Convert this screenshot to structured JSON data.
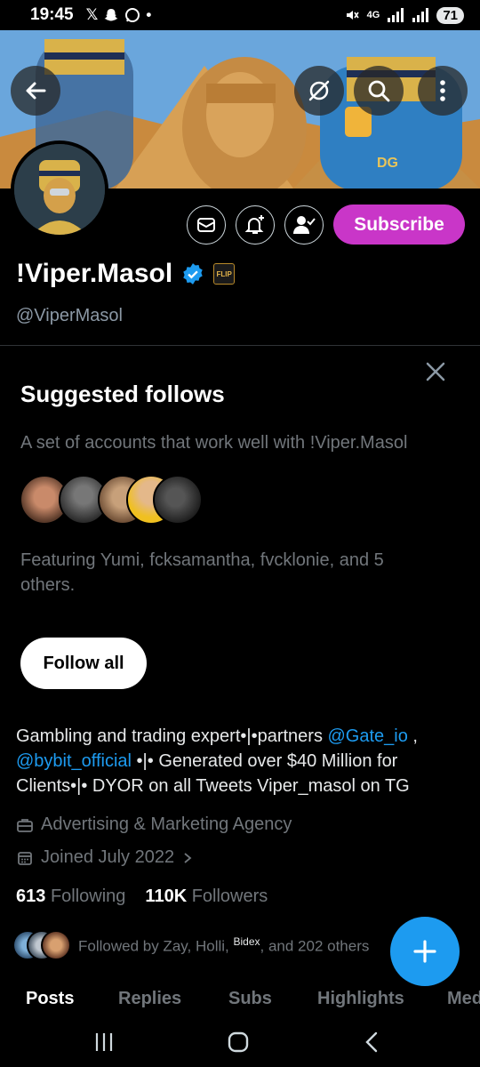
{
  "status_bar": {
    "time": "19:45",
    "notif_icons": [
      "x-icon",
      "snapchat-icon",
      "whatsapp-icon",
      "dot-icon"
    ],
    "network": "4G",
    "battery": "71"
  },
  "header_buttons": [
    "back-icon",
    "hide-icon",
    "search-icon",
    "more-icon"
  ],
  "profile": {
    "display_name": "!Viper.Masol",
    "handle": "@ViperMasol",
    "badge_label": "FLIP"
  },
  "actions": {
    "subscribe_label": "Subscribe"
  },
  "suggested": {
    "title": "Suggested follows",
    "subtitle": "A set of accounts that work well with !Viper.Masol",
    "featuring": "Featuring Yumi, fcksamantha, fvcklonie, and 5 others.",
    "follow_all_label": "Follow all"
  },
  "bio": {
    "part1": "Gambling and trading expert•|•partners ",
    "mention1": "@Gate_io",
    "part2": " , ",
    "mention2": "@bybit_official",
    "part3": " •|• Generated over $40 Million for Clients•|• DYOR on all Tweets  Viper_masol on TG",
    "category": "Advertising & Marketing Agency",
    "joined": "Joined July 2022"
  },
  "stats": {
    "following_count": "613",
    "following_label": "Following",
    "followers_count": "110K",
    "followers_label": "Followers"
  },
  "followed_by": {
    "prefix": "Followed by Zay, Holli, ",
    "third": "Bidex",
    "suffix": ", and 202 others"
  },
  "tabs": [
    "Posts",
    "Replies",
    "Subs",
    "Highlights",
    "Media"
  ],
  "colors": {
    "accent": "#1d9bf0",
    "subscribe": "#c936c8",
    "background": "#000000"
  }
}
